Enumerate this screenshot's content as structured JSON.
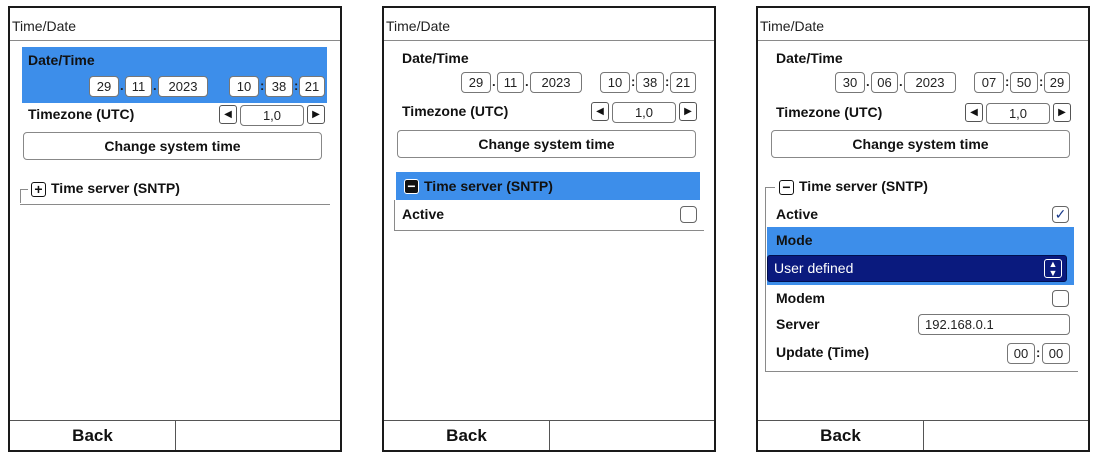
{
  "screens": [
    {
      "title": "Time/Date",
      "datetime_label": "Date/Time",
      "day": "29",
      "month": "11",
      "year": "2023",
      "hour": "10",
      "minute": "38",
      "second": "21",
      "timezone_label": "Timezone (UTC)",
      "timezone_value": "1,0",
      "change_button": "Change system time",
      "sntp_label": "Time server (SNTP)",
      "back_label": "Back"
    },
    {
      "title": "Time/Date",
      "datetime_label": "Date/Time",
      "day": "29",
      "month": "11",
      "year": "2023",
      "hour": "10",
      "minute": "38",
      "second": "21",
      "timezone_label": "Timezone (UTC)",
      "timezone_value": "1,0",
      "change_button": "Change system time",
      "sntp_label": "Time server (SNTP)",
      "active_label": "Active",
      "active_checked": false,
      "back_label": "Back"
    },
    {
      "title": "Time/Date",
      "datetime_label": "Date/Time",
      "day": "30",
      "month": "06",
      "year": "2023",
      "hour": "07",
      "minute": "50",
      "second": "29",
      "timezone_label": "Timezone (UTC)",
      "timezone_value": "1,0",
      "change_button": "Change system time",
      "sntp_label": "Time server (SNTP)",
      "active_label": "Active",
      "active_check": "✓",
      "mode_label": "Mode",
      "mode_value": "User defined",
      "modem_label": "Modem",
      "server_label": "Server",
      "server_value": "192.168.0.1",
      "update_label": "Update (Time)",
      "update_hour": "00",
      "update_minute": "00",
      "back_label": "Back"
    }
  ],
  "separators": {
    "date": ".",
    "time": ":"
  },
  "icons": {
    "left": "◀",
    "right": "▶",
    "plus": "+",
    "minus": "−",
    "spin_up": "▲",
    "spin_down": "▼"
  },
  "colors": {
    "highlight": "#3d8eea",
    "dropdown": "#0a1a7e"
  }
}
